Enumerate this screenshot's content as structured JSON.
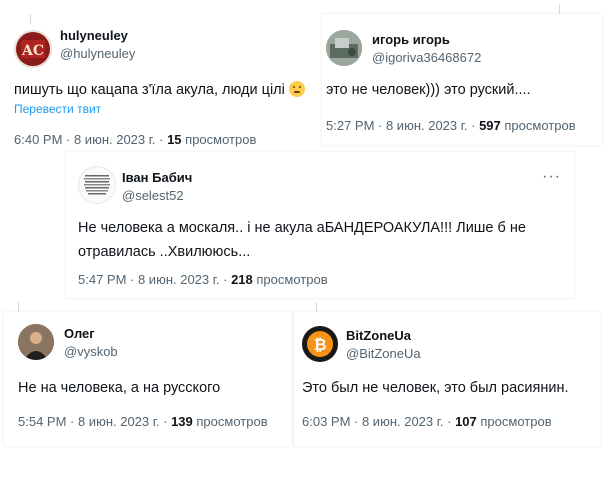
{
  "tweets": [
    {
      "name": "hulyneuley",
      "handle": "@hulyneuley",
      "text": "пишуть що кацапа з'їла акула, люди цілі",
      "translate": "Перевести твит",
      "time": "6:40 PM · 8 июн. 2023 г. · ",
      "views": "15",
      "views_label": " просмотров",
      "avatar_text": "AC"
    },
    {
      "name": "игорь игорь",
      "handle": "@igoriva36468672",
      "text": "это не человек))) это руский....",
      "time": "5:27 PM · 8 июн. 2023 г. · ",
      "views": "597",
      "views_label": " просмотров"
    },
    {
      "name": "Іван Бабич",
      "handle": "@selest52",
      "text": "Не человека а москаля.. і не акула аБАНДЕРОАКУЛА!!! Лише б не отравилась ..Хвилююсь...",
      "time": "5:47 PM · 8 июн. 2023 г. · ",
      "views": "218",
      "views_label": " просмотров",
      "more": "···"
    },
    {
      "name": "Олег",
      "handle": "@vyskob",
      "text": "Не на человека, а на русского",
      "time": "5:54 PM · 8 июн. 2023 г. · ",
      "views": "139",
      "views_label": " просмотров"
    },
    {
      "name": "BitZoneUa",
      "handle": "@BitZoneUa",
      "text": "Это был не человек, это был расиянин.",
      "time": "6:03 PM · 8 июн. 2023 г. · ",
      "views": "107",
      "views_label": " просмотров",
      "avatar_text": "₿"
    }
  ],
  "colors": {
    "text": "#0f1419",
    "secondary": "#536471",
    "link": "#1d9bf0",
    "bitcoin": "#f7931a"
  }
}
